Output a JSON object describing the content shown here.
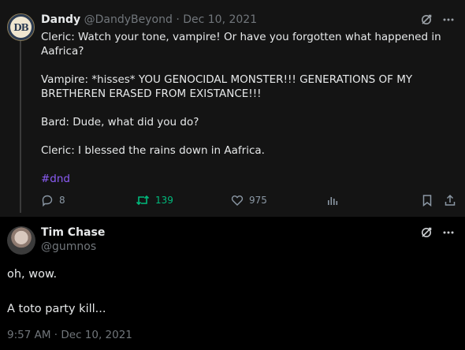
{
  "parent_tweet": {
    "avatar_initials": "DB",
    "display_name": "Dandy",
    "handle": "@DandyBeyond",
    "separator": "·",
    "date": "Dec 10, 2021",
    "text_lines": [
      "Cleric: Watch your tone, vampire! Or have you forgotten what happened in Aafrica?",
      "Vampire: *hisses* YOU GENOCIDAL MONSTER!!! GENERATIONS OF MY BRETHEREN ERASED FROM EXISTANCE!!!",
      "Bard: Dude, what did you do?",
      "Cleric: I blessed the rains down in Aafrica."
    ],
    "hashtag": "#dnd",
    "stats": {
      "replies": "8",
      "retweets": "139",
      "likes": "975"
    },
    "icons": [
      "translate-icon",
      "more-icon",
      "reply-icon",
      "retweet-icon",
      "like-icon",
      "analytics-icon",
      "bookmark-icon",
      "share-icon"
    ]
  },
  "reply_tweet": {
    "display_name": "Tim Chase",
    "handle": "@gumnos",
    "text_lines": [
      "oh, wow.",
      "A toto party kill..."
    ],
    "timestamp": "9:57 AM · Dec 10, 2021",
    "icons": [
      "translate-icon",
      "more-icon"
    ]
  },
  "colors": {
    "hashtag": "#8b5cf6",
    "retweet_active": "#00ba7c",
    "muted": "#71767b",
    "parent_bg": "#141414"
  }
}
